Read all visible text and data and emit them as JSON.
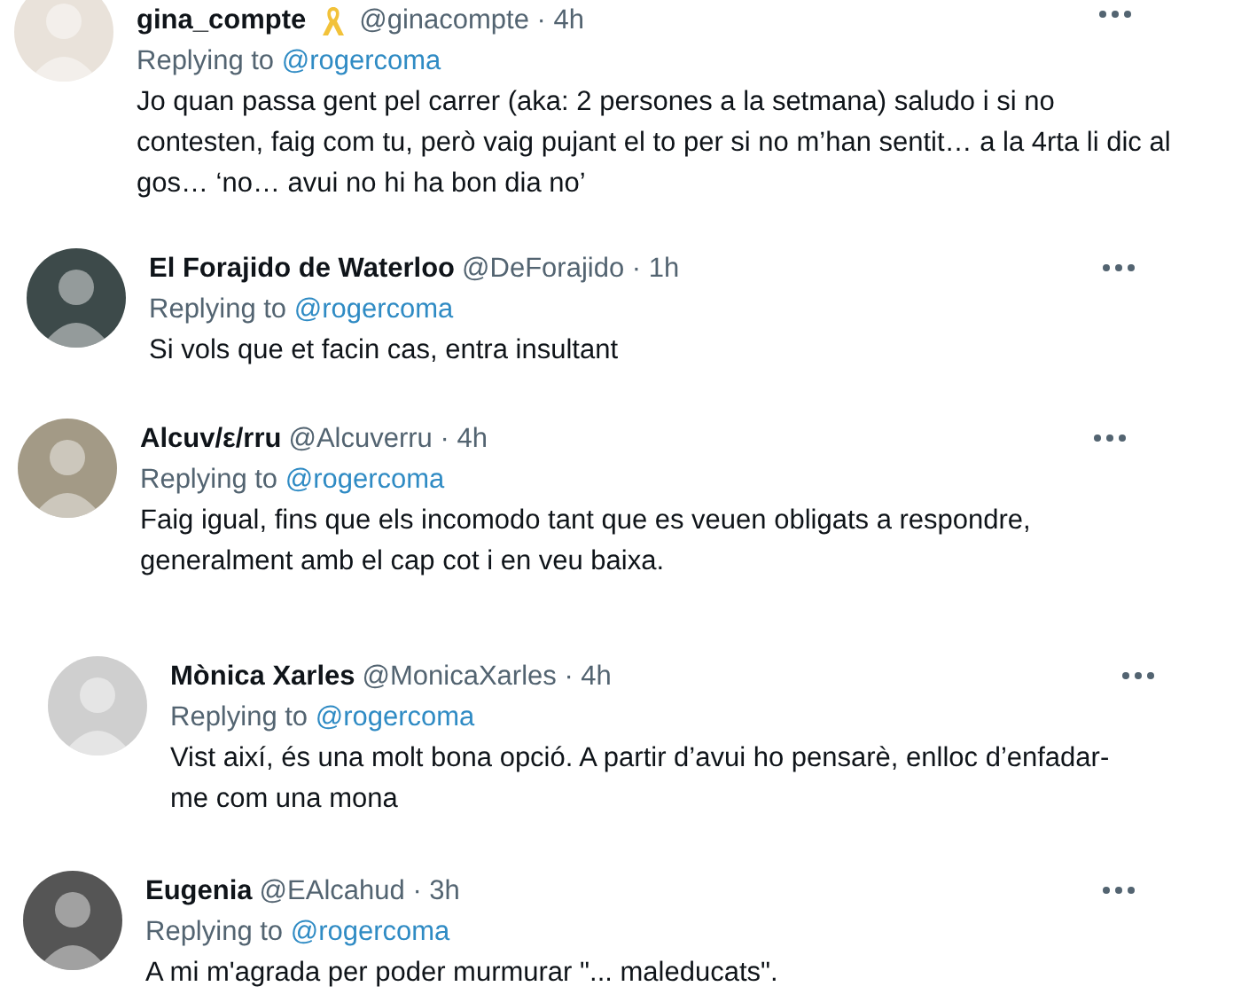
{
  "tweets": [
    {
      "name": "gina_compte",
      "ribbon": true,
      "meta": "@ginacompte · 4h",
      "replying": "Replying to",
      "reply_to": "@rogercoma",
      "text": "Jo quan passa gent pel carrer (aka: 2 persones a la setmana) saludo i si no contesten, faig com tu, però vaig pujant el to per si no m’han sentit… a la 4rta li dic al gos… ‘no… avui no hi ha bon dia no’"
    },
    {
      "name": "El Forajido de Waterloo",
      "ribbon": false,
      "meta": "@DeForajido · 1h",
      "replying": "Replying to",
      "reply_to": "@rogercoma",
      "text": "Si vols que et facin cas, entra insultant"
    },
    {
      "name": "Alcuv/ε/rru",
      "ribbon": false,
      "meta": "@Alcuverru · 4h",
      "replying": "Replying to",
      "reply_to": "@rogercoma",
      "text": "Faig igual, fins que els incomodo tant que es veuen obligats a respondre, generalment amb el cap cot i en veu baixa."
    },
    {
      "name": "Mònica Xarles",
      "ribbon": false,
      "meta": "@MonicaXarles · 4h",
      "replying": "Replying to",
      "reply_to": "@rogercoma",
      "text": "Vist així, és una molt bona opció. A partir d’avui ho pensarè, enlloc d’enfadar-me com una mona"
    },
    {
      "name": "Eugenia",
      "ribbon": false,
      "meta": "@EAlcahud · 3h",
      "replying": "Replying to",
      "reply_to": "@rogercoma",
      "text": "A mi m'agrada per poder murmurar \"... maleducats\"."
    }
  ]
}
